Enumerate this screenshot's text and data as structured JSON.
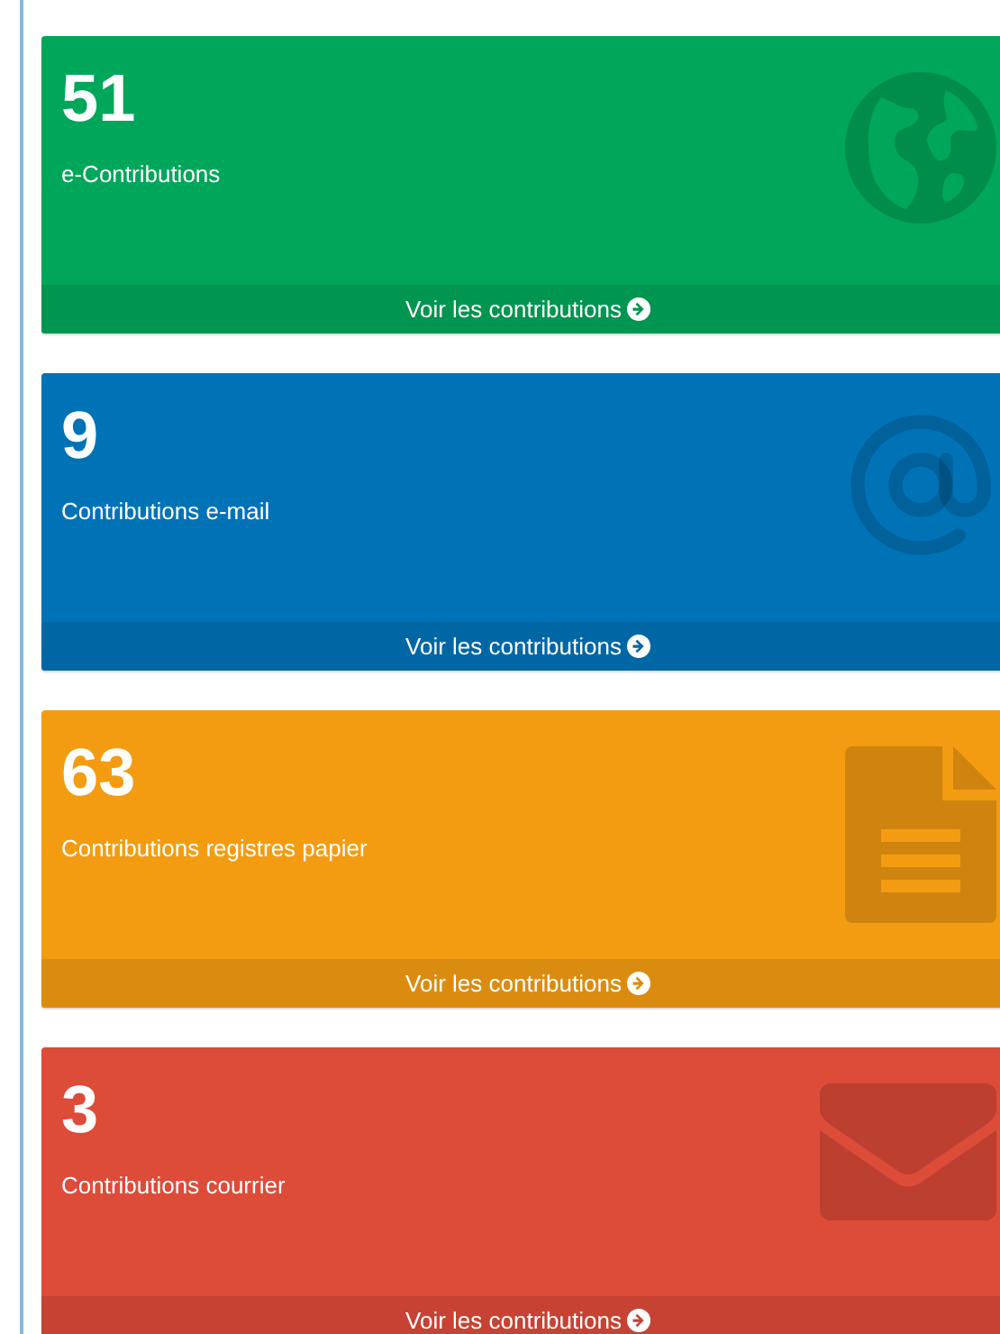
{
  "cards": [
    {
      "count": "51",
      "label": "e-Contributions",
      "link": "Voir les contributions",
      "color": "#00a65a",
      "kind": "globe"
    },
    {
      "count": "9",
      "label": "Contributions e-mail",
      "link": "Voir les contributions",
      "color": "#0073b7",
      "kind": "at"
    },
    {
      "count": "63",
      "label": "Contributions registres papier",
      "link": "Voir les contributions",
      "color": "#f39c12",
      "kind": "document"
    },
    {
      "count": "3",
      "label": "Contributions courrier",
      "link": "Voir les contributions",
      "color": "#dd4b39",
      "kind": "envelope"
    }
  ]
}
